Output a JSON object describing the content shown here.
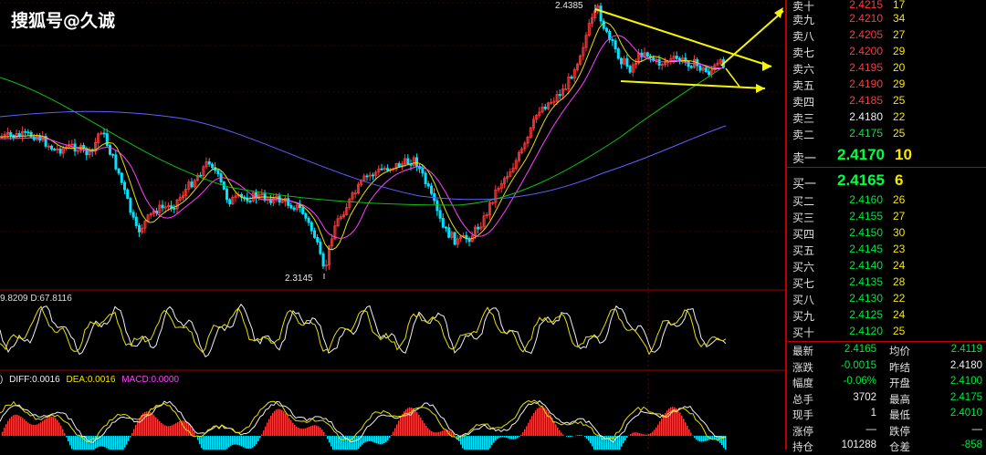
{
  "watermark": "搜狐号@久诚",
  "chart": {
    "high_label": "2.4385",
    "low_label": "2.3145",
    "kdj_legend": "9.8209 D:67.8116",
    "macd_legend_prefix": ")",
    "diff": "DIFF:0.0016",
    "dea": "DEA:0.0016",
    "macd": "MACD:0.0000",
    "colors": {
      "up": "#ff3a3a",
      "down": "#00e5ff",
      "ma_yellow": "#e8e000",
      "ma_pink": "#ff40ff",
      "ma_green": "#10c010",
      "ma_blue": "#6060ff",
      "arrow": "#f5f500"
    }
  },
  "orderbook": {
    "asks": [
      {
        "label": "卖十",
        "price": "2.4215",
        "vol": "17"
      },
      {
        "label": "卖九",
        "price": "2.4210",
        "vol": "34"
      },
      {
        "label": "卖八",
        "price": "2.4205",
        "vol": "27"
      },
      {
        "label": "卖七",
        "price": "2.4200",
        "vol": "29"
      },
      {
        "label": "卖六",
        "price": "2.4195",
        "vol": "20"
      },
      {
        "label": "卖五",
        "price": "2.4190",
        "vol": "29"
      },
      {
        "label": "卖四",
        "price": "2.4185",
        "vol": "25"
      },
      {
        "label": "卖三",
        "price": "2.4180",
        "vol": "22"
      },
      {
        "label": "卖二",
        "price": "2.4175",
        "vol": "25"
      }
    ],
    "best_ask": {
      "label": "卖一",
      "price": "2.4170",
      "vol": "10"
    },
    "best_bid": {
      "label": "买一",
      "price": "2.4165",
      "vol": "6"
    },
    "bids": [
      {
        "label": "买二",
        "price": "2.4160",
        "vol": "26"
      },
      {
        "label": "买三",
        "price": "2.4155",
        "vol": "27"
      },
      {
        "label": "买四",
        "price": "2.4150",
        "vol": "30"
      },
      {
        "label": "买五",
        "price": "2.4145",
        "vol": "23"
      },
      {
        "label": "买六",
        "price": "2.4140",
        "vol": "24"
      },
      {
        "label": "买七",
        "price": "2.4135",
        "vol": "28"
      },
      {
        "label": "买八",
        "price": "2.4130",
        "vol": "22"
      },
      {
        "label": "买九",
        "price": "2.4125",
        "vol": "24"
      },
      {
        "label": "买十",
        "price": "2.4120",
        "vol": "25"
      }
    ]
  },
  "stats": [
    {
      "l1": "最新",
      "v1": "2.4165",
      "c1": "grn",
      "l2": "均价",
      "v2": "2.4119",
      "c2": "grn"
    },
    {
      "l1": "涨跌",
      "v1": "-0.0015",
      "c1": "grn",
      "l2": "昨结",
      "v2": "2.4180",
      "c2": "wht"
    },
    {
      "l1": "幅度",
      "v1": "-0.06%",
      "c1": "grn",
      "l2": "开盘",
      "v2": "2.4100",
      "c2": "grn"
    },
    {
      "l1": "总手",
      "v1": "3702",
      "c1": "wht",
      "l2": "最高",
      "v2": "2.4175",
      "c2": "grn"
    },
    {
      "l1": "现手",
      "v1": "1",
      "c1": "wht",
      "l2": "最低",
      "v2": "2.4010",
      "c2": "grn"
    },
    {
      "l1": "涨停",
      "v1": "—",
      "c1": "wht",
      "l2": "跌停",
      "v2": "—",
      "c2": "wht"
    },
    {
      "l1": "持仓",
      "v1": "101288",
      "c1": "wht",
      "l2": "仓差",
      "v2": "-858",
      "c2": "grn"
    }
  ]
}
